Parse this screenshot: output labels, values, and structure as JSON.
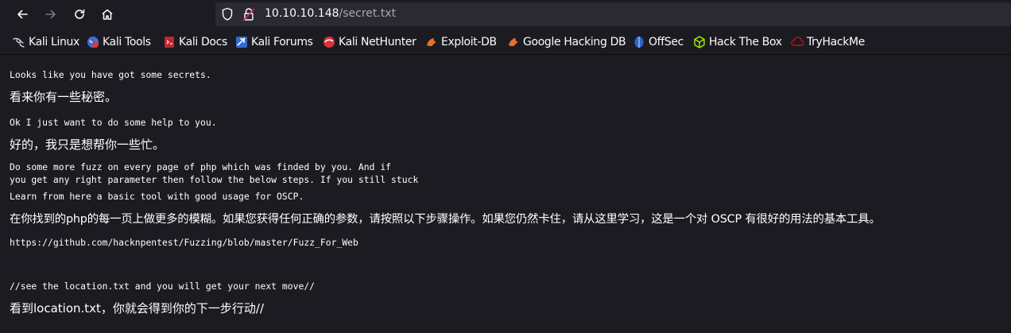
{
  "url": {
    "host": "10.10.10.148",
    "path": "/secret.txt"
  },
  "bookmarks": [
    {
      "label": "Kali Linux",
      "icon": "kali-dragon-icon"
    },
    {
      "label": "Kali Tools",
      "icon": "kali-tools-icon"
    },
    {
      "label": "Kali Docs",
      "icon": "kali-docs-icon"
    },
    {
      "label": "Kali Forums",
      "icon": "kali-forums-icon"
    },
    {
      "label": "Kali NetHunter",
      "icon": "kali-nethunter-icon"
    },
    {
      "label": "Exploit-DB",
      "icon": "exploit-db-icon"
    },
    {
      "label": "Google Hacking DB",
      "icon": "google-hacking-db-icon"
    },
    {
      "label": "OffSec",
      "icon": "offsec-icon"
    },
    {
      "label": "Hack The Box",
      "icon": "hack-the-box-icon"
    },
    {
      "label": "TryHackMe",
      "icon": "tryhackme-icon"
    }
  ],
  "document": {
    "lines": [
      "Looks like you have got some secrets.",
      "看来你有一些秘密。",
      "Ok I just want to do some help to you.",
      "好的，我只是想帮你一些忙。",
      "Do some more fuzz on every page of php which was finded by you. And if",
      "you get any right parameter then follow the below steps. If you still stuck",
      "Learn from here a basic tool with good usage for OSCP.",
      "在你找到的php的每一页上做更多的模糊。如果您获得任何正确的参数，请按照以下步骤操作。如果您仍然卡住，请从这里学习，这是一个对 OSCP 有很好的用法的基本工具。",
      "https://github.com/hacknpentest/Fuzzing/blob/master/Fuzz_For_Web",
      "//see the location.txt and you will get your next move//",
      "看到location.txt，你就会得到你的下一步行动//"
    ]
  }
}
